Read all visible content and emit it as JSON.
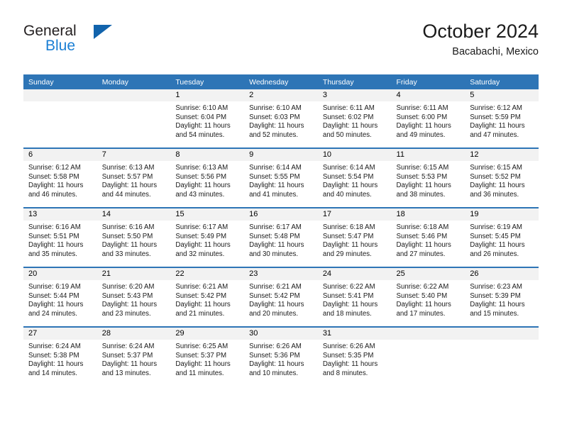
{
  "brand": {
    "name_top": "General",
    "name_bottom": "Blue",
    "triangle_color": "#1163ac",
    "blue_color": "#1b7fd4"
  },
  "header": {
    "title": "October 2024",
    "location": "Bacabachi, Mexico"
  },
  "theme": {
    "header_blue": "#2e75b6",
    "daynum_gray": "#f2f2f2",
    "text": "#1a1a1a"
  },
  "weekdays": [
    "Sunday",
    "Monday",
    "Tuesday",
    "Wednesday",
    "Thursday",
    "Friday",
    "Saturday"
  ],
  "weeks": [
    [
      {
        "day": "",
        "blank": true
      },
      {
        "day": "",
        "blank": true
      },
      {
        "day": "1",
        "sunrise": "Sunrise: 6:10 AM",
        "sunset": "Sunset: 6:04 PM",
        "daylight1": "Daylight: 11 hours",
        "daylight2": "and 54 minutes."
      },
      {
        "day": "2",
        "sunrise": "Sunrise: 6:10 AM",
        "sunset": "Sunset: 6:03 PM",
        "daylight1": "Daylight: 11 hours",
        "daylight2": "and 52 minutes."
      },
      {
        "day": "3",
        "sunrise": "Sunrise: 6:11 AM",
        "sunset": "Sunset: 6:02 PM",
        "daylight1": "Daylight: 11 hours",
        "daylight2": "and 50 minutes."
      },
      {
        "day": "4",
        "sunrise": "Sunrise: 6:11 AM",
        "sunset": "Sunset: 6:00 PM",
        "daylight1": "Daylight: 11 hours",
        "daylight2": "and 49 minutes."
      },
      {
        "day": "5",
        "sunrise": "Sunrise: 6:12 AM",
        "sunset": "Sunset: 5:59 PM",
        "daylight1": "Daylight: 11 hours",
        "daylight2": "and 47 minutes."
      }
    ],
    [
      {
        "day": "6",
        "sunrise": "Sunrise: 6:12 AM",
        "sunset": "Sunset: 5:58 PM",
        "daylight1": "Daylight: 11 hours",
        "daylight2": "and 46 minutes."
      },
      {
        "day": "7",
        "sunrise": "Sunrise: 6:13 AM",
        "sunset": "Sunset: 5:57 PM",
        "daylight1": "Daylight: 11 hours",
        "daylight2": "and 44 minutes."
      },
      {
        "day": "8",
        "sunrise": "Sunrise: 6:13 AM",
        "sunset": "Sunset: 5:56 PM",
        "daylight1": "Daylight: 11 hours",
        "daylight2": "and 43 minutes."
      },
      {
        "day": "9",
        "sunrise": "Sunrise: 6:14 AM",
        "sunset": "Sunset: 5:55 PM",
        "daylight1": "Daylight: 11 hours",
        "daylight2": "and 41 minutes."
      },
      {
        "day": "10",
        "sunrise": "Sunrise: 6:14 AM",
        "sunset": "Sunset: 5:54 PM",
        "daylight1": "Daylight: 11 hours",
        "daylight2": "and 40 minutes."
      },
      {
        "day": "11",
        "sunrise": "Sunrise: 6:15 AM",
        "sunset": "Sunset: 5:53 PM",
        "daylight1": "Daylight: 11 hours",
        "daylight2": "and 38 minutes."
      },
      {
        "day": "12",
        "sunrise": "Sunrise: 6:15 AM",
        "sunset": "Sunset: 5:52 PM",
        "daylight1": "Daylight: 11 hours",
        "daylight2": "and 36 minutes."
      }
    ],
    [
      {
        "day": "13",
        "sunrise": "Sunrise: 6:16 AM",
        "sunset": "Sunset: 5:51 PM",
        "daylight1": "Daylight: 11 hours",
        "daylight2": "and 35 minutes."
      },
      {
        "day": "14",
        "sunrise": "Sunrise: 6:16 AM",
        "sunset": "Sunset: 5:50 PM",
        "daylight1": "Daylight: 11 hours",
        "daylight2": "and 33 minutes."
      },
      {
        "day": "15",
        "sunrise": "Sunrise: 6:17 AM",
        "sunset": "Sunset: 5:49 PM",
        "daylight1": "Daylight: 11 hours",
        "daylight2": "and 32 minutes."
      },
      {
        "day": "16",
        "sunrise": "Sunrise: 6:17 AM",
        "sunset": "Sunset: 5:48 PM",
        "daylight1": "Daylight: 11 hours",
        "daylight2": "and 30 minutes."
      },
      {
        "day": "17",
        "sunrise": "Sunrise: 6:18 AM",
        "sunset": "Sunset: 5:47 PM",
        "daylight1": "Daylight: 11 hours",
        "daylight2": "and 29 minutes."
      },
      {
        "day": "18",
        "sunrise": "Sunrise: 6:18 AM",
        "sunset": "Sunset: 5:46 PM",
        "daylight1": "Daylight: 11 hours",
        "daylight2": "and 27 minutes."
      },
      {
        "day": "19",
        "sunrise": "Sunrise: 6:19 AM",
        "sunset": "Sunset: 5:45 PM",
        "daylight1": "Daylight: 11 hours",
        "daylight2": "and 26 minutes."
      }
    ],
    [
      {
        "day": "20",
        "sunrise": "Sunrise: 6:19 AM",
        "sunset": "Sunset: 5:44 PM",
        "daylight1": "Daylight: 11 hours",
        "daylight2": "and 24 minutes."
      },
      {
        "day": "21",
        "sunrise": "Sunrise: 6:20 AM",
        "sunset": "Sunset: 5:43 PM",
        "daylight1": "Daylight: 11 hours",
        "daylight2": "and 23 minutes."
      },
      {
        "day": "22",
        "sunrise": "Sunrise: 6:21 AM",
        "sunset": "Sunset: 5:42 PM",
        "daylight1": "Daylight: 11 hours",
        "daylight2": "and 21 minutes."
      },
      {
        "day": "23",
        "sunrise": "Sunrise: 6:21 AM",
        "sunset": "Sunset: 5:42 PM",
        "daylight1": "Daylight: 11 hours",
        "daylight2": "and 20 minutes."
      },
      {
        "day": "24",
        "sunrise": "Sunrise: 6:22 AM",
        "sunset": "Sunset: 5:41 PM",
        "daylight1": "Daylight: 11 hours",
        "daylight2": "and 18 minutes."
      },
      {
        "day": "25",
        "sunrise": "Sunrise: 6:22 AM",
        "sunset": "Sunset: 5:40 PM",
        "daylight1": "Daylight: 11 hours",
        "daylight2": "and 17 minutes."
      },
      {
        "day": "26",
        "sunrise": "Sunrise: 6:23 AM",
        "sunset": "Sunset: 5:39 PM",
        "daylight1": "Daylight: 11 hours",
        "daylight2": "and 15 minutes."
      }
    ],
    [
      {
        "day": "27",
        "sunrise": "Sunrise: 6:24 AM",
        "sunset": "Sunset: 5:38 PM",
        "daylight1": "Daylight: 11 hours",
        "daylight2": "and 14 minutes."
      },
      {
        "day": "28",
        "sunrise": "Sunrise: 6:24 AM",
        "sunset": "Sunset: 5:37 PM",
        "daylight1": "Daylight: 11 hours",
        "daylight2": "and 13 minutes."
      },
      {
        "day": "29",
        "sunrise": "Sunrise: 6:25 AM",
        "sunset": "Sunset: 5:37 PM",
        "daylight1": "Daylight: 11 hours",
        "daylight2": "and 11 minutes."
      },
      {
        "day": "30",
        "sunrise": "Sunrise: 6:26 AM",
        "sunset": "Sunset: 5:36 PM",
        "daylight1": "Daylight: 11 hours",
        "daylight2": "and 10 minutes."
      },
      {
        "day": "31",
        "sunrise": "Sunrise: 6:26 AM",
        "sunset": "Sunset: 5:35 PM",
        "daylight1": "Daylight: 11 hours",
        "daylight2": "and 8 minutes."
      },
      {
        "day": "",
        "blank": true
      },
      {
        "day": "",
        "blank": true
      }
    ]
  ]
}
